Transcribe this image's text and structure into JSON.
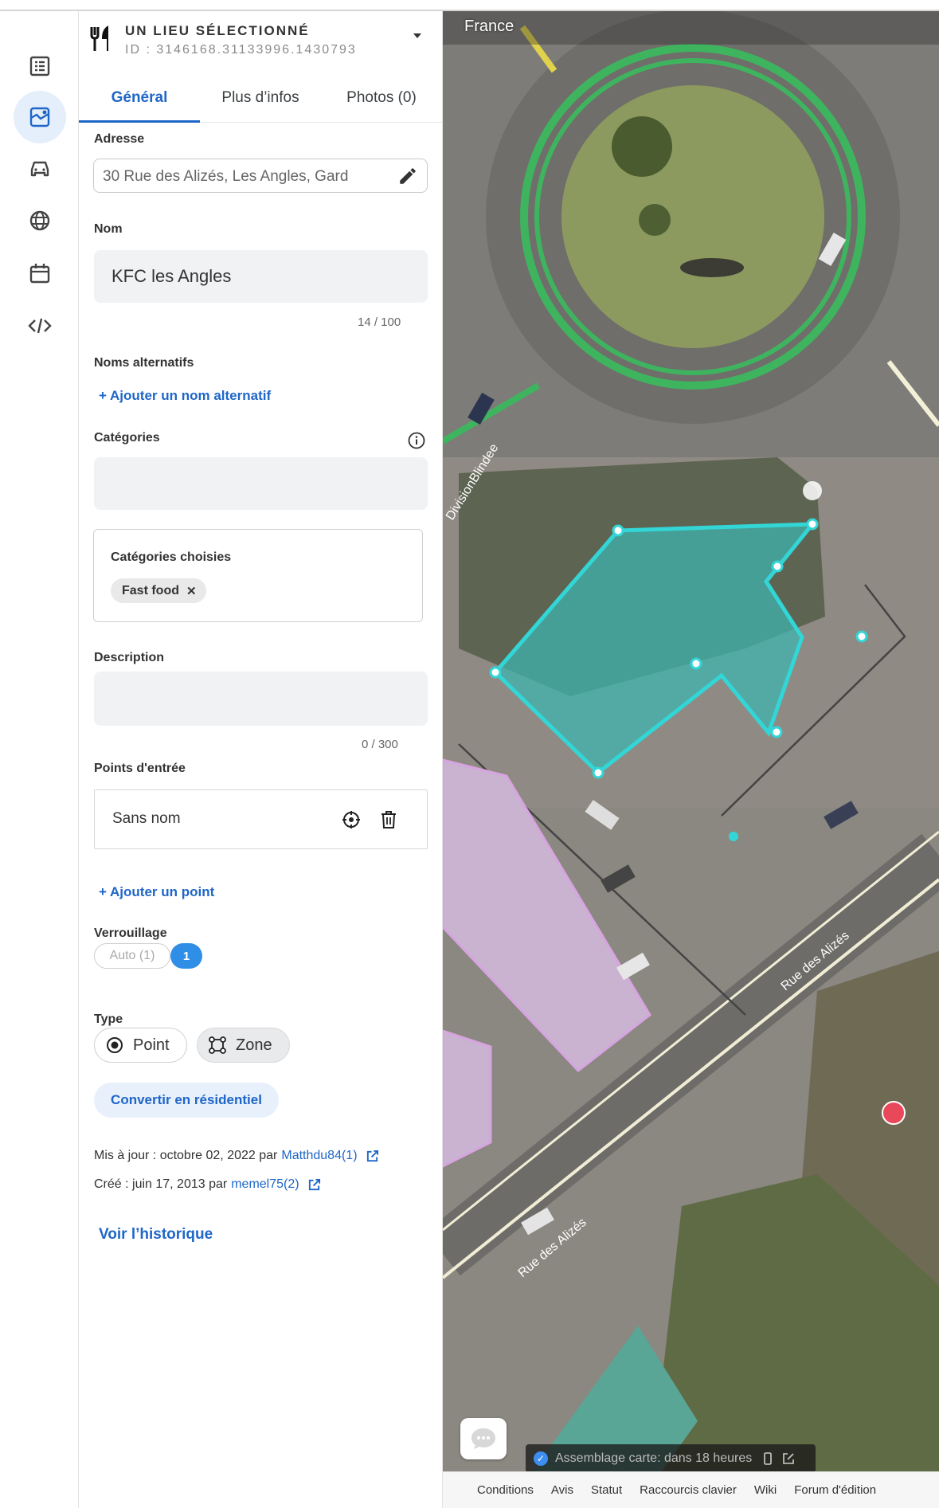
{
  "header": {
    "title": "UN LIEU SÉLECTIONNÉ",
    "id": "ID : 3146168.31133996.1430793"
  },
  "tabs": [
    {
      "label": "Général",
      "active": true
    },
    {
      "label": "Plus d’infos",
      "active": false
    },
    {
      "label": "Photos (0)",
      "active": false
    }
  ],
  "address": {
    "label": "Adresse",
    "value": "30 Rue des Alizés, Les Angles, Gard"
  },
  "name": {
    "label": "Nom",
    "value": "KFC les Angles",
    "counter": "14 / 100"
  },
  "alt_names": {
    "label": "Noms alternatifs",
    "add_link": "+ Ajouter un nom alternatif"
  },
  "categories": {
    "label": "Catégories",
    "chosen_title": "Catégories choisies",
    "chosen": [
      "Fast food"
    ],
    "chip_remove": "✕"
  },
  "description": {
    "label": "Description",
    "value": "",
    "counter": "0 / 300"
  },
  "entry_points": {
    "label": "Points d'entrée",
    "items": [
      {
        "name": "Sans nom"
      }
    ],
    "add_link": "+ Ajouter un point"
  },
  "lock": {
    "label": "Verrouillage",
    "auto_label": "Auto (1)",
    "level": "1"
  },
  "type": {
    "label": "Type",
    "options": [
      "Point",
      "Zone"
    ],
    "selected": "Zone"
  },
  "convert_button": "Convertir en résidentiel",
  "meta": {
    "updated_prefix": "Mis à jour : octobre 02, 2022 par",
    "updated_by": "Matthdu84(1)",
    "created_prefix": "Créé : juin 17, 2013 par",
    "created_by": "memel75(2)"
  },
  "history_link": "Voir l’historique",
  "map": {
    "country": "France",
    "street_labels": [
      "DivisionBlindee",
      "Rue des Alizés",
      "Rue des Alizés"
    ],
    "toast": "Assemblage carte: dans 18 heures",
    "footer_links": [
      "Conditions",
      "Avis",
      "Statut",
      "Raccourcis clavier",
      "Wiki",
      "Forum d'édition"
    ]
  },
  "colors": {
    "accent": "#1e66c8",
    "selection": "#33d6d6",
    "roundabout": "#3fb45f"
  },
  "icons": {
    "rail": [
      "list-icon",
      "map-edit-icon",
      "car-icon",
      "globe-icon",
      "calendar-icon",
      "code-icon"
    ],
    "category": "fork-knife-icon"
  }
}
